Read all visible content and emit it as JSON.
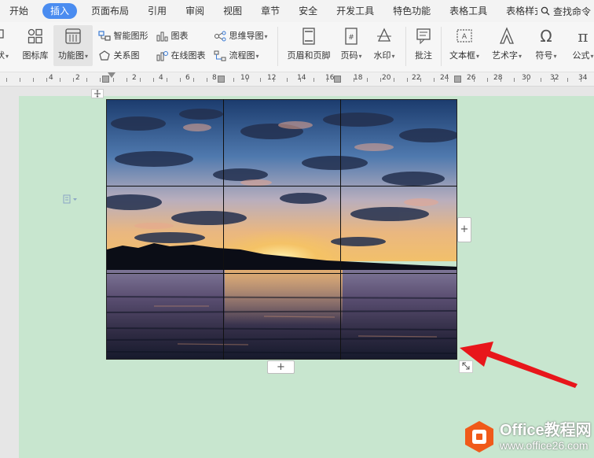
{
  "menubar": {
    "tabs": [
      "开始",
      "插入",
      "页面布局",
      "引用",
      "审阅",
      "视图",
      "章节",
      "安全",
      "开发工具",
      "特色功能",
      "表格工具",
      "表格样式"
    ],
    "active_tab": "插入",
    "search_label": "查找命令",
    "active_color": "#4a8cf0"
  },
  "ribbon": {
    "left_cut_label": "状",
    "icon_lib_label": "图标库",
    "func_chart_label": "功能图",
    "smart_art_label": "智能图形",
    "chart_label": "图表",
    "relation_label": "关系图",
    "online_chart_label": "在线图表",
    "mindmap_label": "思维导图",
    "flowchart_label": "流程图",
    "header_footer_label": "页眉和页脚",
    "page_num_label": "页码",
    "watermark_label": "水印",
    "comment_label": "批注",
    "textbox_label": "文本框",
    "wordart_label": "艺术字",
    "symbol_label": "符号",
    "formula_label": "公式"
  },
  "ruler": {
    "labels": [
      "4",
      "2",
      "2",
      "4",
      "6",
      "8",
      "10",
      "12",
      "14",
      "16",
      "18",
      "20",
      "22",
      "24",
      "26",
      "28",
      "30",
      "32",
      "34"
    ]
  },
  "table": {
    "rows": 3,
    "cols": 3,
    "add_row_symbol": "+",
    "add_col_symbol": "+"
  },
  "watermark": {
    "title": "Office教程网",
    "url": "www.office26.com",
    "brand_color": "#f05a1a"
  },
  "annotation": {
    "arrow_color": "#e8161b"
  }
}
